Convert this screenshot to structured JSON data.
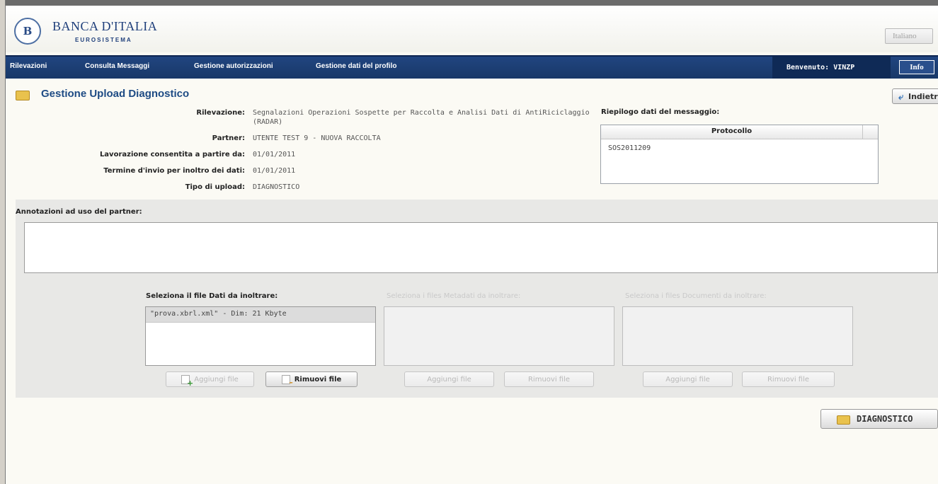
{
  "header": {
    "bank_name": "BANCA D'ITALIA",
    "bank_sub": "EUROSISTEMA",
    "logo_text": "B",
    "language": "Italiano"
  },
  "nav": {
    "items": [
      "Rilevazioni",
      "Consulta Messaggi",
      "Gestione autorizzazioni",
      "Gestione dati del profilo"
    ],
    "welcome_label": "Benvenuto:",
    "welcome_user": "VINZP",
    "info": "Info"
  },
  "page": {
    "title": "Gestione Upload Diagnostico",
    "back_button": "Indietro"
  },
  "details": {
    "rilevazione_label": "Rilevazione:",
    "rilevazione_value": "Segnalazioni Operazioni Sospette per Raccolta e Analisi Dati di AntiRiciclaggio",
    "rilevazione_value2": "(RADAR)",
    "partner_label": "Partner:",
    "partner_value": "UTENTE TEST 9 - NUOVA RACCOLTA",
    "lavorazione_label": "Lavorazione consentita a partire da:",
    "lavorazione_value": "01/01/2011",
    "termine_label": "Termine d'invio per inoltro dei dati:",
    "termine_value": "01/01/2011",
    "tipo_label": "Tipo di upload:",
    "tipo_value": "DIAGNOSTICO"
  },
  "riepilogo": {
    "label": "Riepilogo dati del messaggio:",
    "column": "Protocollo",
    "value": "SOS2011209"
  },
  "annotazioni": {
    "label": "Annotazioni ad uso del partner:",
    "value": ""
  },
  "upload": {
    "dati_label": "Seleziona il file Dati da inoltrare:",
    "metadati_label": "Seleziona i files Metadati da inoltrare:",
    "documenti_label": "Seleziona i files Documenti da inoltrare:",
    "dati_file": "\"prova.xbrl.xml\" - Dim: 21 Kbyte",
    "add_label": "Aggiungi file",
    "remove_label": "Rimuovi file"
  },
  "action": {
    "diagnostico": "DIAGNOSTICO"
  }
}
